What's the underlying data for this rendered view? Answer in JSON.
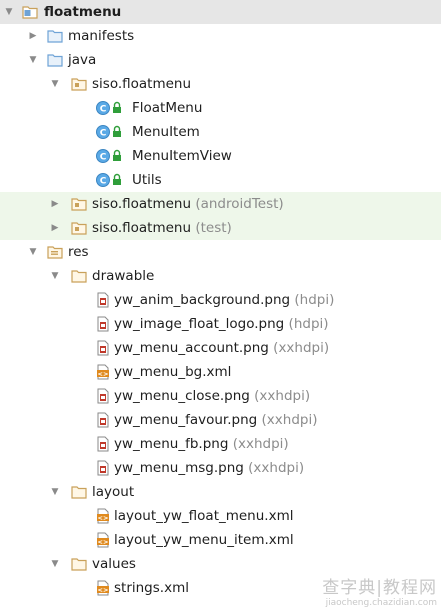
{
  "tree": {
    "rows": [
      {
        "label": "floatmenu",
        "hint": "",
        "type": "module",
        "level": 0,
        "arrow": "expanded",
        "state": "selected",
        "bold": true
      },
      {
        "label": "manifests",
        "hint": "",
        "type": "folder-blue",
        "level": 1,
        "arrow": "collapsed",
        "state": "",
        "bold": false
      },
      {
        "label": "java",
        "hint": "",
        "type": "folder-blue",
        "level": 1,
        "arrow": "expanded",
        "state": "",
        "bold": false
      },
      {
        "label": "siso.floatmenu",
        "hint": "",
        "type": "package",
        "level": 2,
        "arrow": "expanded",
        "state": "",
        "bold": false
      },
      {
        "label": "FloatMenu",
        "hint": "",
        "type": "class",
        "level": 3,
        "arrow": "none",
        "state": "",
        "bold": false
      },
      {
        "label": "MenuItem",
        "hint": "",
        "type": "class",
        "level": 3,
        "arrow": "none",
        "state": "",
        "bold": false
      },
      {
        "label": "MenuItemView",
        "hint": "",
        "type": "class",
        "level": 3,
        "arrow": "none",
        "state": "",
        "bold": false
      },
      {
        "label": "Utils",
        "hint": "",
        "type": "class",
        "level": 3,
        "arrow": "none",
        "state": "",
        "bold": false
      },
      {
        "label": "siso.floatmenu",
        "hint": "(androidTest)",
        "type": "package",
        "level": 2,
        "arrow": "collapsed",
        "state": "green",
        "bold": false
      },
      {
        "label": "siso.floatmenu",
        "hint": "(test)",
        "type": "package",
        "level": 2,
        "arrow": "collapsed",
        "state": "green",
        "bold": false
      },
      {
        "label": "res",
        "hint": "",
        "type": "res-folder",
        "level": 1,
        "arrow": "expanded",
        "state": "",
        "bold": false
      },
      {
        "label": "drawable",
        "hint": "",
        "type": "folder",
        "level": 2,
        "arrow": "expanded",
        "state": "",
        "bold": false
      },
      {
        "label": "yw_anim_background.png",
        "hint": "(hdpi)",
        "type": "image",
        "level": 3,
        "arrow": "none",
        "state": "",
        "bold": false
      },
      {
        "label": "yw_image_float_logo.png",
        "hint": "(hdpi)",
        "type": "image",
        "level": 3,
        "arrow": "none",
        "state": "",
        "bold": false
      },
      {
        "label": "yw_menu_account.png",
        "hint": "(xxhdpi)",
        "type": "image",
        "level": 3,
        "arrow": "none",
        "state": "",
        "bold": false
      },
      {
        "label": "yw_menu_bg.xml",
        "hint": "",
        "type": "xml",
        "level": 3,
        "arrow": "none",
        "state": "",
        "bold": false
      },
      {
        "label": "yw_menu_close.png",
        "hint": "(xxhdpi)",
        "type": "image",
        "level": 3,
        "arrow": "none",
        "state": "",
        "bold": false
      },
      {
        "label": "yw_menu_favour.png",
        "hint": "(xxhdpi)",
        "type": "image",
        "level": 3,
        "arrow": "none",
        "state": "",
        "bold": false
      },
      {
        "label": "yw_menu_fb.png",
        "hint": "(xxhdpi)",
        "type": "image",
        "level": 3,
        "arrow": "none",
        "state": "",
        "bold": false
      },
      {
        "label": "yw_menu_msg.png",
        "hint": "(xxhdpi)",
        "type": "image",
        "level": 3,
        "arrow": "none",
        "state": "",
        "bold": false
      },
      {
        "label": "layout",
        "hint": "",
        "type": "folder",
        "level": 2,
        "arrow": "expanded",
        "state": "",
        "bold": false
      },
      {
        "label": "layout_yw_float_menu.xml",
        "hint": "",
        "type": "xml",
        "level": 3,
        "arrow": "none",
        "state": "",
        "bold": false
      },
      {
        "label": "layout_yw_menu_item.xml",
        "hint": "",
        "type": "xml",
        "level": 3,
        "arrow": "none",
        "state": "",
        "bold": false
      },
      {
        "label": "values",
        "hint": "",
        "type": "folder",
        "level": 2,
        "arrow": "expanded",
        "state": "",
        "bold": false
      },
      {
        "label": "strings.xml",
        "hint": "",
        "type": "xml",
        "level": 3,
        "arrow": "none",
        "state": "",
        "bold": false
      }
    ]
  },
  "watermark": {
    "main": "查字典|教程网",
    "sub": "jiaocheng.chazidian.com"
  },
  "colors": {
    "selected_row": "#e6e6e6",
    "test_row": "#eef7ea",
    "folder_blue": "#6fa3d6",
    "folder_brown": "#c9a15a",
    "class_circle": "#5aa9e6",
    "lock_green": "#2f9e3a",
    "xml_orange": "#e08a1e",
    "image_red": "#c0392b",
    "hint_text": "#8c8c8c"
  }
}
